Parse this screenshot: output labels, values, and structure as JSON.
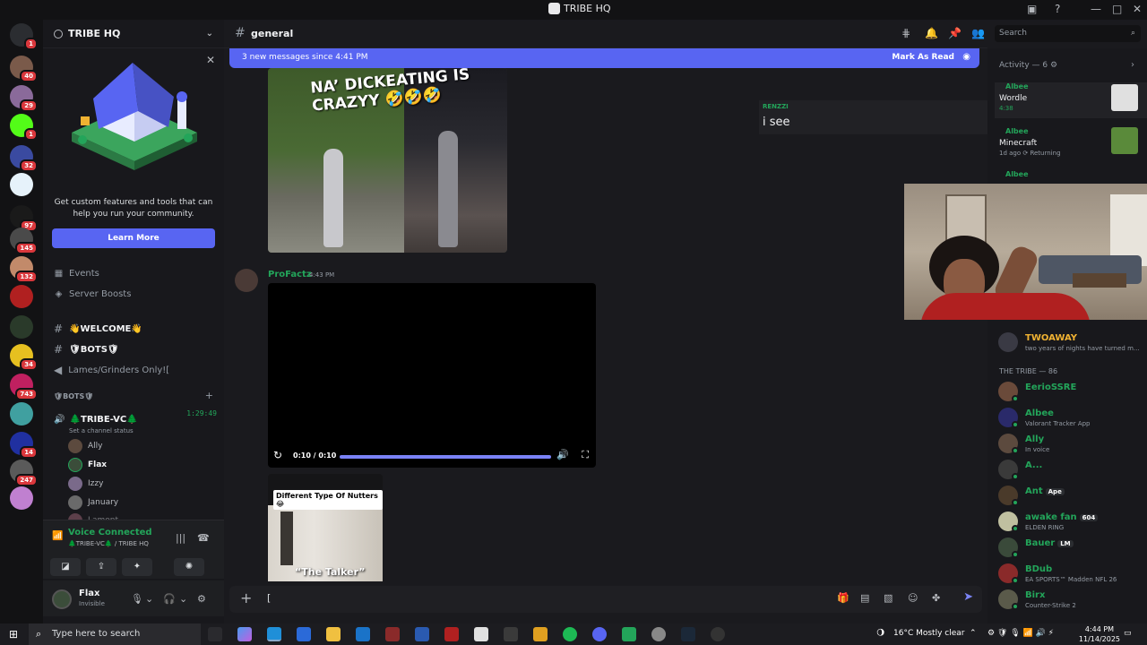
{
  "window": {
    "title": "TRIBE HQ"
  },
  "servers": [
    {
      "badge": "1",
      "color": "#2b2d31"
    },
    {
      "badge": "40",
      "color": "#7a5a4a"
    },
    {
      "badge": "29",
      "color": "#8a6a9a"
    },
    {
      "badge": "1",
      "color": "#53fc18"
    },
    {
      "badge": "32",
      "color": "#3a4aa0"
    },
    {
      "badge": "",
      "color": "#e6f2fa"
    },
    {
      "badge": "97",
      "color": "#1a1a1a"
    },
    {
      "badge": "145",
      "color": "#4a4a4a"
    },
    {
      "badge": "132",
      "color": "#c28a6a"
    },
    {
      "badge": "",
      "color": "#b02020"
    },
    {
      "badge": "",
      "color": "#2a3a2a"
    },
    {
      "badge": "34",
      "color": "#e6c020"
    },
    {
      "badge": "743",
      "color": "#c02060"
    },
    {
      "badge": "",
      "color": "#40a0a0"
    },
    {
      "badge": "14",
      "color": "#2030a0"
    },
    {
      "badge": "247",
      "color": "#5a5a5a"
    },
    {
      "badge": "",
      "color": "#c080d0"
    }
  ],
  "sidebar": {
    "guild_name": "TRIBE HQ",
    "promo": {
      "text": "Get custom features and tools that can help you run your community.",
      "button": "Learn More"
    },
    "events": "Events",
    "boosts": "Server Boosts",
    "channels": [
      {
        "name": "👋WELCOME👋"
      },
      {
        "name": "🛡BOTS🛡"
      },
      {
        "name": "Lames/Grinders Only![",
        "muted": true
      }
    ],
    "category": "🛡BOTS🛡",
    "voice_channel": {
      "name": "🌲TRIBE-VC🌲",
      "time": "1:29:49",
      "status": "Set a channel status"
    },
    "voice_users": [
      "Ally",
      "Flax",
      "Izzy",
      "January",
      "Lamont"
    ]
  },
  "voice_panel": {
    "title": "Voice Connected",
    "subtitle": "🌲TRIBE-VC🌲 / TRIBE HQ"
  },
  "user_panel": {
    "name": "Flax",
    "status": "Invisible"
  },
  "chat": {
    "channel": "general",
    "new_messages": "3 new messages since 4:41 PM",
    "mark_as_read": "Mark As Read",
    "image_caption": "NA’ DICKEATING IS CRAZYY 🤣🤣🤣",
    "message2": {
      "author": "ProFactz",
      "time": "4:43 PM"
    },
    "video": {
      "time": "0:10 / 0:10",
      "progress": 1.0
    },
    "thumb_tag": "Different Type Of Nutters😂",
    "thumb_caption": "“The Talker”",
    "renzzi": {
      "name": "RENZZI",
      "message": "i see"
    },
    "composer_value": "["
  },
  "search": {
    "placeholder": "Search"
  },
  "members": {
    "activity_header": "Activity — 6",
    "activities": [
      {
        "who": "Albee",
        "game": "Wordle",
        "sub": "4:38",
        "art_color": "#d0d0d0"
      },
      {
        "who": "Albee",
        "game": "Minecraft",
        "sub": "1d ago  ⟳ Returning",
        "art_color": "#5a8a3a"
      },
      {
        "who": "Albee",
        "game": "",
        "sub": "",
        "art_color": "#111"
      }
    ],
    "extra": {
      "name": "TWOAWAY",
      "status": "two years of nights have turned m..."
    },
    "section": "THE TRIBE — 86",
    "list": [
      {
        "name": "EerioSSRE",
        "status": "",
        "tag": "",
        "color": "#6a4a3a"
      },
      {
        "name": "Albee",
        "status": "Valorant Tracker App",
        "tag": "",
        "color": "#2a2a6a"
      },
      {
        "name": "Ally",
        "status": "In voice",
        "tag": "",
        "color": "#5c4a3e"
      },
      {
        "name": "A...",
        "status": "",
        "tag": "",
        "color": "#3a3a3a"
      },
      {
        "name": "Ant",
        "status": "",
        "tag": "Ape",
        "color": "#4a3a2a"
      },
      {
        "name": "awake fan",
        "status": "ELDEN RING",
        "tag": "604",
        "color": "#c0c0a0"
      },
      {
        "name": "Bauer",
        "status": "",
        "tag": "LM",
        "color": "#3a4a3a"
      },
      {
        "name": "BDub",
        "status": "EA SPORTS™ Madden NFL 26",
        "tag": "",
        "color": "#8a2a2a"
      },
      {
        "name": "Birx",
        "status": "Counter-Strike 2",
        "tag": "",
        "color": "#5a5a4a"
      }
    ]
  },
  "taskbar": {
    "search_placeholder": "Type here to search",
    "weather": "16°C  Mostly clear",
    "time": "4:44 PM",
    "date": "11/14/2025"
  }
}
